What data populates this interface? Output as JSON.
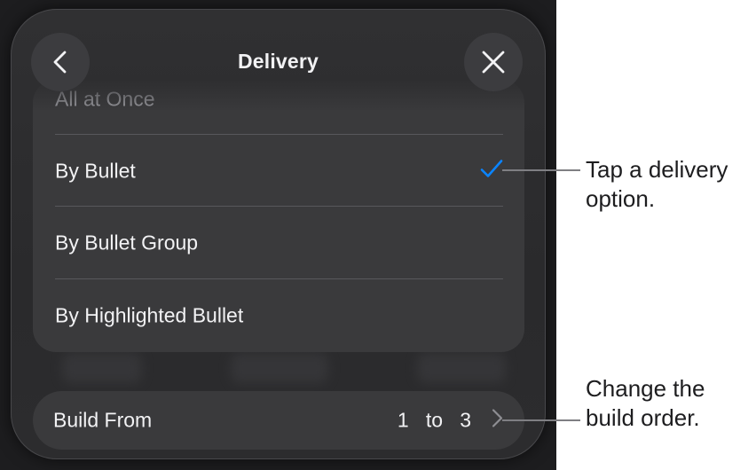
{
  "header": {
    "title": "Delivery",
    "back_icon": "chevron-left-icon",
    "close_icon": "close-icon"
  },
  "delivery_options": [
    {
      "label": "All at Once",
      "selected": false
    },
    {
      "label": "By Bullet",
      "selected": true
    },
    {
      "label": "By Bullet Group",
      "selected": false
    },
    {
      "label": "By Highlighted Bullet",
      "selected": false
    }
  ],
  "build_from": {
    "label": "Build From",
    "start": "1",
    "connector": "to",
    "end": "3",
    "chevron_icon": "chevron-right-icon"
  },
  "callouts": {
    "delivery": {
      "line1": "Tap a delivery",
      "line2": "option."
    },
    "build": {
      "line1": "Change the",
      "line2": "build order."
    }
  },
  "colors": {
    "accent": "#0a84ff",
    "panel": "#2c2c2e",
    "row": "#3a3a3c",
    "text": "#f2f2f4"
  }
}
